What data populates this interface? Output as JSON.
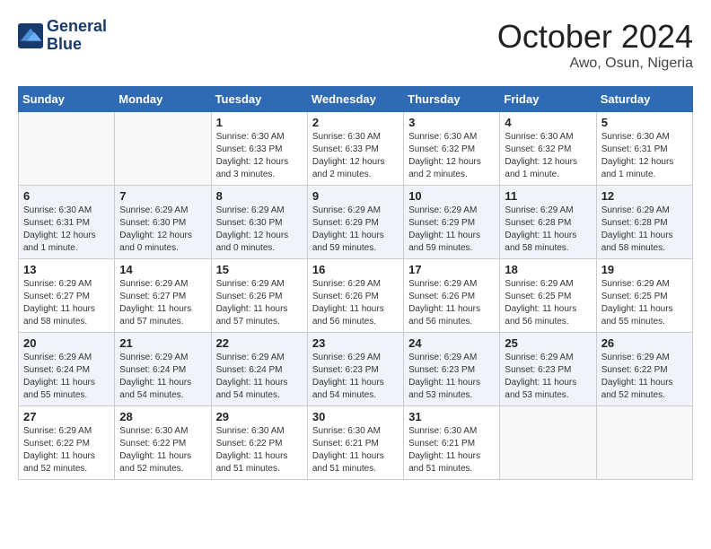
{
  "header": {
    "logo_line1": "General",
    "logo_line2": "Blue",
    "month": "October 2024",
    "location": "Awo, Osun, Nigeria"
  },
  "weekdays": [
    "Sunday",
    "Monday",
    "Tuesday",
    "Wednesday",
    "Thursday",
    "Friday",
    "Saturday"
  ],
  "weeks": [
    [
      {
        "day": "",
        "info": ""
      },
      {
        "day": "",
        "info": ""
      },
      {
        "day": "1",
        "info": "Sunrise: 6:30 AM\nSunset: 6:33 PM\nDaylight: 12 hours and 3 minutes."
      },
      {
        "day": "2",
        "info": "Sunrise: 6:30 AM\nSunset: 6:33 PM\nDaylight: 12 hours and 2 minutes."
      },
      {
        "day": "3",
        "info": "Sunrise: 6:30 AM\nSunset: 6:32 PM\nDaylight: 12 hours and 2 minutes."
      },
      {
        "day": "4",
        "info": "Sunrise: 6:30 AM\nSunset: 6:32 PM\nDaylight: 12 hours and 1 minute."
      },
      {
        "day": "5",
        "info": "Sunrise: 6:30 AM\nSunset: 6:31 PM\nDaylight: 12 hours and 1 minute."
      }
    ],
    [
      {
        "day": "6",
        "info": "Sunrise: 6:30 AM\nSunset: 6:31 PM\nDaylight: 12 hours and 1 minute."
      },
      {
        "day": "7",
        "info": "Sunrise: 6:29 AM\nSunset: 6:30 PM\nDaylight: 12 hours and 0 minutes."
      },
      {
        "day": "8",
        "info": "Sunrise: 6:29 AM\nSunset: 6:30 PM\nDaylight: 12 hours and 0 minutes."
      },
      {
        "day": "9",
        "info": "Sunrise: 6:29 AM\nSunset: 6:29 PM\nDaylight: 11 hours and 59 minutes."
      },
      {
        "day": "10",
        "info": "Sunrise: 6:29 AM\nSunset: 6:29 PM\nDaylight: 11 hours and 59 minutes."
      },
      {
        "day": "11",
        "info": "Sunrise: 6:29 AM\nSunset: 6:28 PM\nDaylight: 11 hours and 58 minutes."
      },
      {
        "day": "12",
        "info": "Sunrise: 6:29 AM\nSunset: 6:28 PM\nDaylight: 11 hours and 58 minutes."
      }
    ],
    [
      {
        "day": "13",
        "info": "Sunrise: 6:29 AM\nSunset: 6:27 PM\nDaylight: 11 hours and 58 minutes."
      },
      {
        "day": "14",
        "info": "Sunrise: 6:29 AM\nSunset: 6:27 PM\nDaylight: 11 hours and 57 minutes."
      },
      {
        "day": "15",
        "info": "Sunrise: 6:29 AM\nSunset: 6:26 PM\nDaylight: 11 hours and 57 minutes."
      },
      {
        "day": "16",
        "info": "Sunrise: 6:29 AM\nSunset: 6:26 PM\nDaylight: 11 hours and 56 minutes."
      },
      {
        "day": "17",
        "info": "Sunrise: 6:29 AM\nSunset: 6:26 PM\nDaylight: 11 hours and 56 minutes."
      },
      {
        "day": "18",
        "info": "Sunrise: 6:29 AM\nSunset: 6:25 PM\nDaylight: 11 hours and 56 minutes."
      },
      {
        "day": "19",
        "info": "Sunrise: 6:29 AM\nSunset: 6:25 PM\nDaylight: 11 hours and 55 minutes."
      }
    ],
    [
      {
        "day": "20",
        "info": "Sunrise: 6:29 AM\nSunset: 6:24 PM\nDaylight: 11 hours and 55 minutes."
      },
      {
        "day": "21",
        "info": "Sunrise: 6:29 AM\nSunset: 6:24 PM\nDaylight: 11 hours and 54 minutes."
      },
      {
        "day": "22",
        "info": "Sunrise: 6:29 AM\nSunset: 6:24 PM\nDaylight: 11 hours and 54 minutes."
      },
      {
        "day": "23",
        "info": "Sunrise: 6:29 AM\nSunset: 6:23 PM\nDaylight: 11 hours and 54 minutes."
      },
      {
        "day": "24",
        "info": "Sunrise: 6:29 AM\nSunset: 6:23 PM\nDaylight: 11 hours and 53 minutes."
      },
      {
        "day": "25",
        "info": "Sunrise: 6:29 AM\nSunset: 6:23 PM\nDaylight: 11 hours and 53 minutes."
      },
      {
        "day": "26",
        "info": "Sunrise: 6:29 AM\nSunset: 6:22 PM\nDaylight: 11 hours and 52 minutes."
      }
    ],
    [
      {
        "day": "27",
        "info": "Sunrise: 6:29 AM\nSunset: 6:22 PM\nDaylight: 11 hours and 52 minutes."
      },
      {
        "day": "28",
        "info": "Sunrise: 6:30 AM\nSunset: 6:22 PM\nDaylight: 11 hours and 52 minutes."
      },
      {
        "day": "29",
        "info": "Sunrise: 6:30 AM\nSunset: 6:22 PM\nDaylight: 11 hours and 51 minutes."
      },
      {
        "day": "30",
        "info": "Sunrise: 6:30 AM\nSunset: 6:21 PM\nDaylight: 11 hours and 51 minutes."
      },
      {
        "day": "31",
        "info": "Sunrise: 6:30 AM\nSunset: 6:21 PM\nDaylight: 11 hours and 51 minutes."
      },
      {
        "day": "",
        "info": ""
      },
      {
        "day": "",
        "info": ""
      }
    ]
  ]
}
